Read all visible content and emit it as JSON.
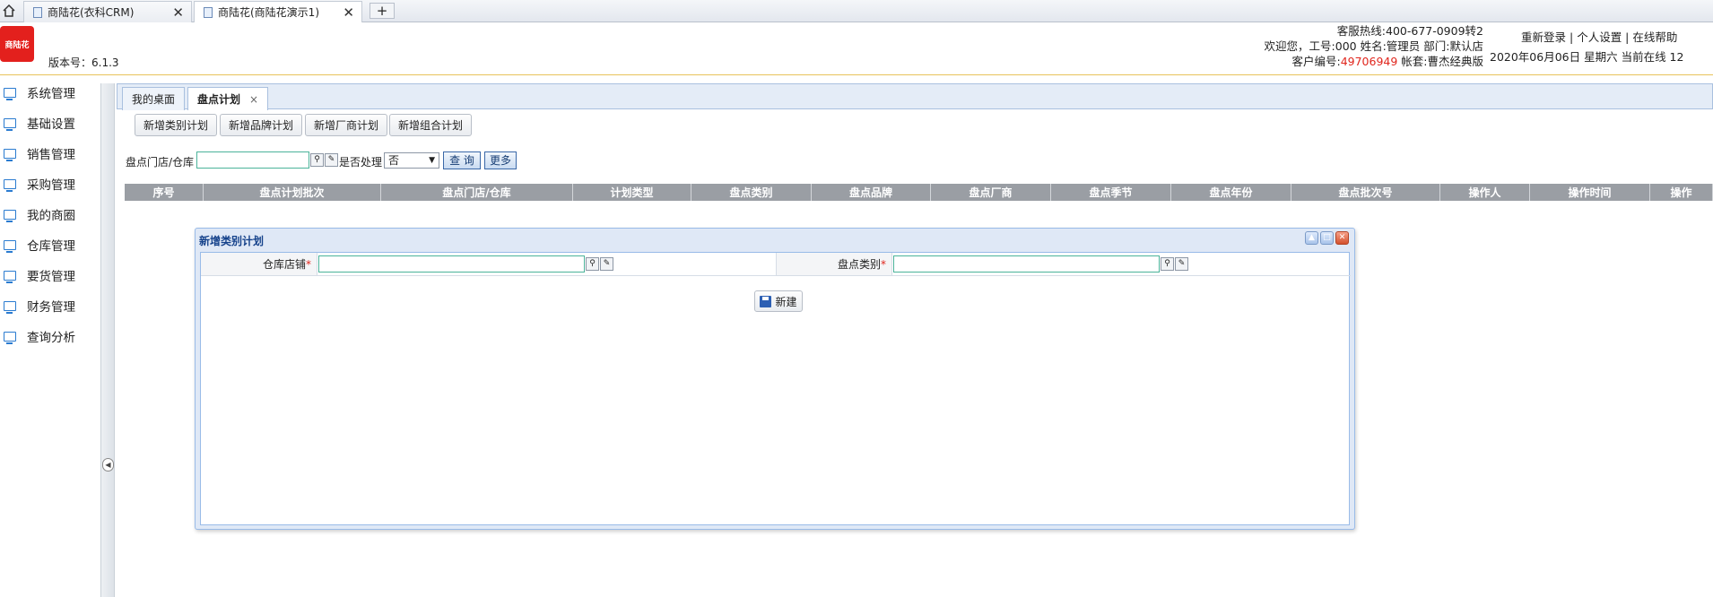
{
  "browser": {
    "tabs": [
      {
        "label": "商陆花(衣科CRM)",
        "close": "✕"
      },
      {
        "label": "商陆花(商陆花演示1)",
        "close": "✕"
      }
    ],
    "new_tab": "+"
  },
  "header": {
    "logo_text": "商陆花",
    "version": "版本号：6.1.3",
    "hotline": "客服热线:400-677-0909转2",
    "welcome": "欢迎您，工号:000 姓名:管理员 部门:默认店",
    "customer_label": "客户编号:",
    "customer_no": "49706949",
    "account": " 帐套:曹杰经典版",
    "links": {
      "relogin": "重新登录",
      "sep1": " | ",
      "settings": "个人设置",
      "sep2": " | ",
      "help": "在线帮助"
    },
    "date": "2020年06月06日 星期六 当前在线 12"
  },
  "sidebar": {
    "items": [
      {
        "label": "系统管理"
      },
      {
        "label": "基础设置"
      },
      {
        "label": "销售管理"
      },
      {
        "label": "采购管理"
      },
      {
        "label": "我的商圈"
      },
      {
        "label": "仓库管理"
      },
      {
        "label": "要货管理"
      },
      {
        "label": "财务管理"
      },
      {
        "label": "查询分析"
      }
    ],
    "collapse_glyph": "◀"
  },
  "panel_tabs": [
    {
      "label": "我的桌面"
    },
    {
      "label": "盘点计划",
      "close": "×"
    }
  ],
  "toolbar": {
    "buttons": [
      "新增类别计划",
      "新增品牌计划",
      "新增厂商计划",
      "新增组合计划"
    ]
  },
  "filter": {
    "store_label": "盘点门店/仓库",
    "store_value": "",
    "processed_label": "是否处理",
    "processed_value": "否",
    "search_btn": "查 询",
    "more_btn": "更多"
  },
  "grid": {
    "columns": [
      "序号",
      "盘点计划批次",
      "盘点门店/仓库",
      "计划类型",
      "盘点类别",
      "盘点品牌",
      "盘点厂商",
      "盘点季节",
      "盘点年份",
      "盘点批次号",
      "操作人",
      "操作时间",
      "操作"
    ]
  },
  "dialog": {
    "title": "新增类别计划",
    "field1_label": "仓库店铺",
    "field2_label": "盘点类别",
    "required_mark": "*",
    "create_btn": "新建"
  },
  "colors": {
    "accent_red": "#e0261d",
    "grid_header": "#9a9ea4",
    "dialog_border": "#99bbe8",
    "input_border": "#4bb39a"
  }
}
